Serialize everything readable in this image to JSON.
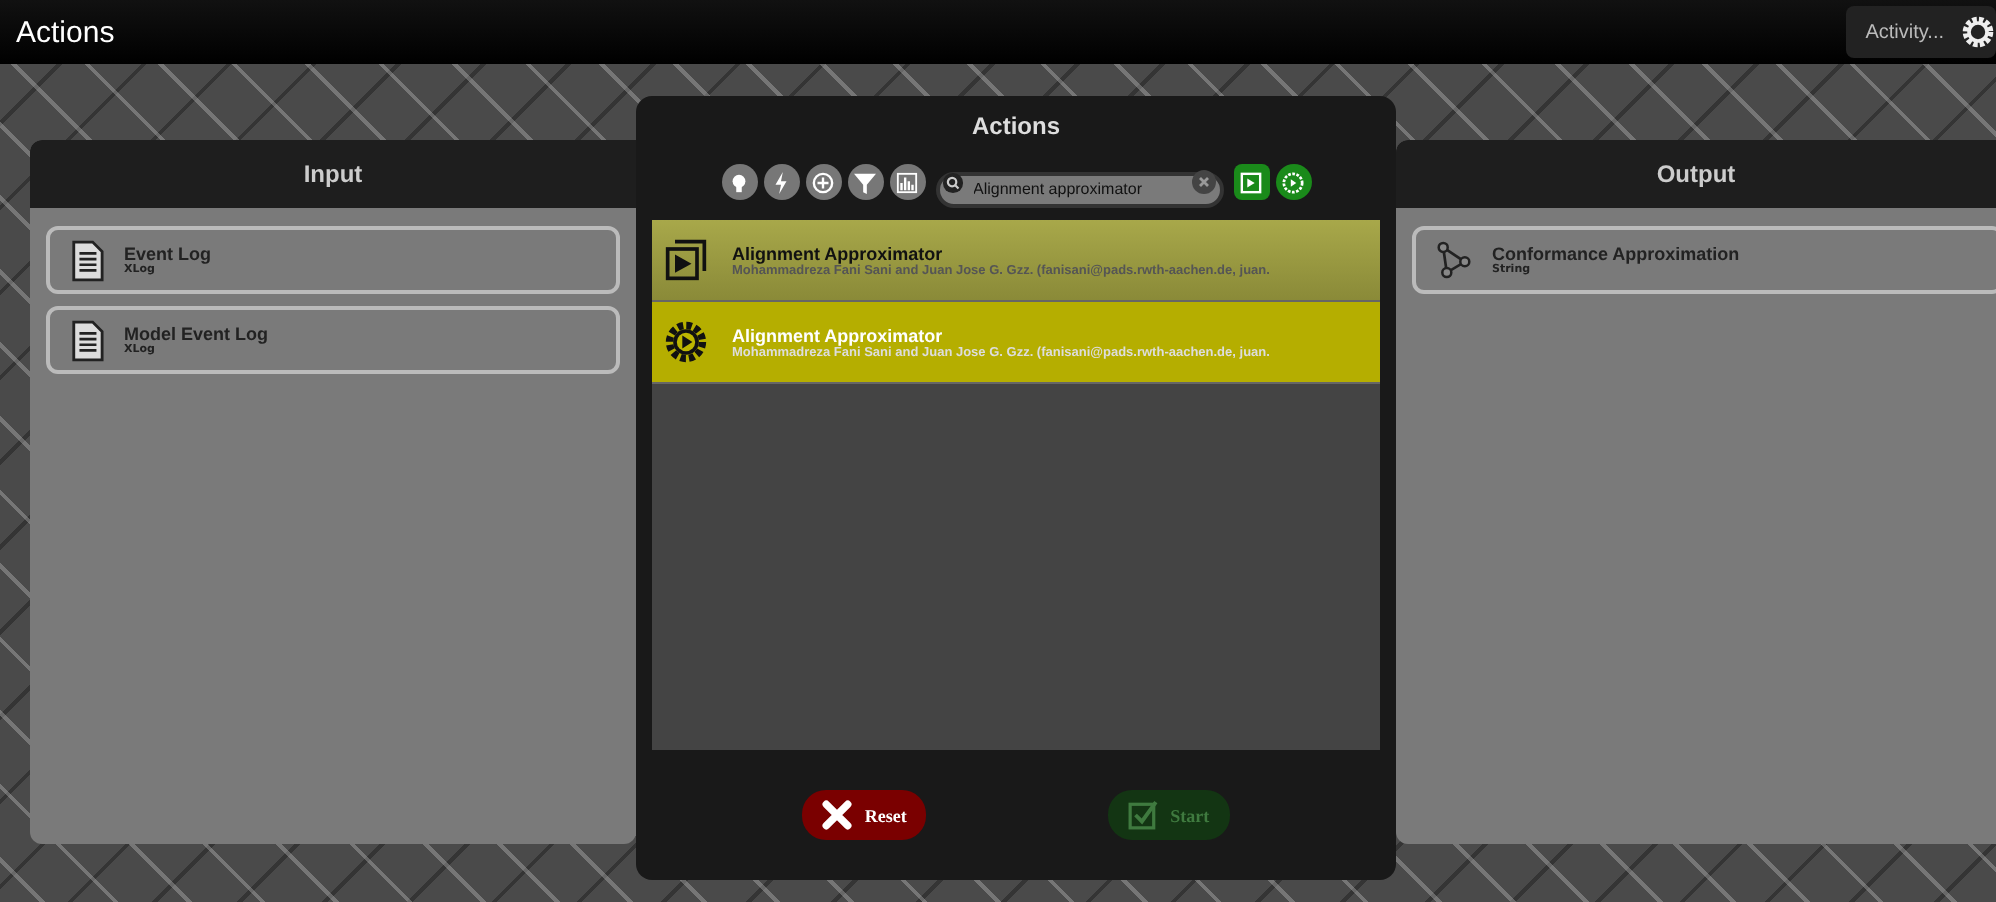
{
  "window": {
    "title": "Actions"
  },
  "activity": {
    "label": "Activity..."
  },
  "input_panel": {
    "title": "Input",
    "items": [
      {
        "name": "Event Log",
        "type": "XLog"
      },
      {
        "name": "Model Event Log",
        "type": "XLog"
      }
    ]
  },
  "output_panel": {
    "title": "Output",
    "items": [
      {
        "name": "Conformance Approximation",
        "type": "String"
      }
    ]
  },
  "dialog": {
    "title": "Actions",
    "search": {
      "value": "Alignment approximator"
    },
    "actions": [
      {
        "kind": "visualizer",
        "name": "Alignment Approximator",
        "author": "Mohammadreza Fani Sani and Juan Jose G. Gzz. (fanisani@pads.rwth-aachen.de, juan.",
        "selected": false
      },
      {
        "kind": "plugin",
        "name": "Alignment Approximator",
        "author": "Mohammadreza Fani Sani and Juan Jose G. Gzz. (fanisani@pads.rwth-aachen.de, juan.",
        "selected": true
      }
    ],
    "buttons": [
      {
        "kind": "reset",
        "label": "Reset",
        "disabled": false
      },
      {
        "kind": "start",
        "label": "Start",
        "disabled": true
      }
    ]
  }
}
